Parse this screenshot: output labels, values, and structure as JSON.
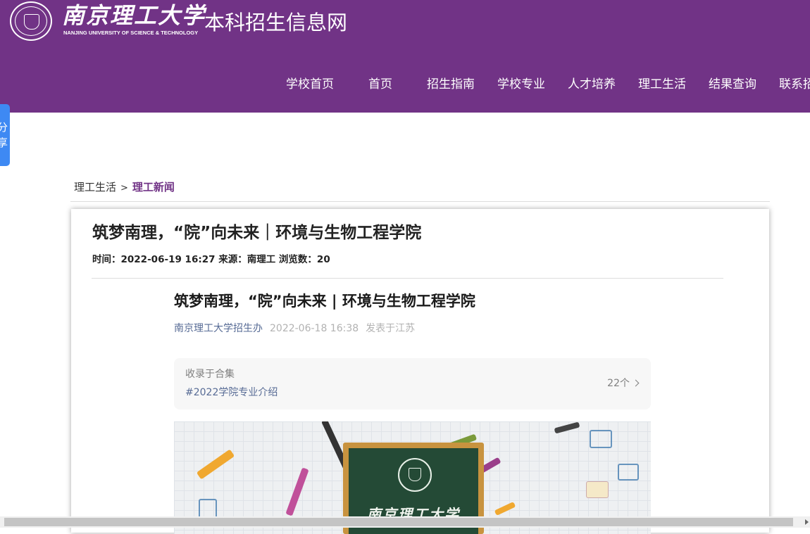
{
  "header": {
    "university_name_cn": "南京理工大学",
    "university_name_en": "NANJING UNIVERSITY OF SCIENCE & TECHNOLOGY",
    "site_name": "本科招生信息网",
    "background_color": "#713386",
    "nav": [
      {
        "label": "学校首页"
      },
      {
        "label": "首页"
      },
      {
        "label": "招生指南"
      },
      {
        "label": "学校专业"
      },
      {
        "label": "人才培养"
      },
      {
        "label": "理工生活"
      },
      {
        "label": "结果查询"
      },
      {
        "label": "联系招"
      }
    ]
  },
  "share_tab": {
    "label": "分享"
  },
  "breadcrumb": {
    "parent": "理工生活",
    "separator": ">",
    "current": "理工新闻",
    "current_color": "#713386"
  },
  "article": {
    "title": "筑梦南理，“院”向未来｜环境与生物工程学院",
    "meta": "时间：2022-06-19 16:27 来源：南理工 浏览数：20"
  },
  "wechat_post": {
    "title": "筑梦南理，“院”向未来 | 环境与生物工程学院",
    "author": "南京理工大学招生办",
    "date": "2022-06-18 16:38",
    "location": "发表于江苏",
    "collection": {
      "label": "收录于合集",
      "tag": "#2022学院专业介绍",
      "count": "22个"
    },
    "cover": {
      "board_text": "南京理工大学",
      "board_color": "#244a36"
    }
  }
}
